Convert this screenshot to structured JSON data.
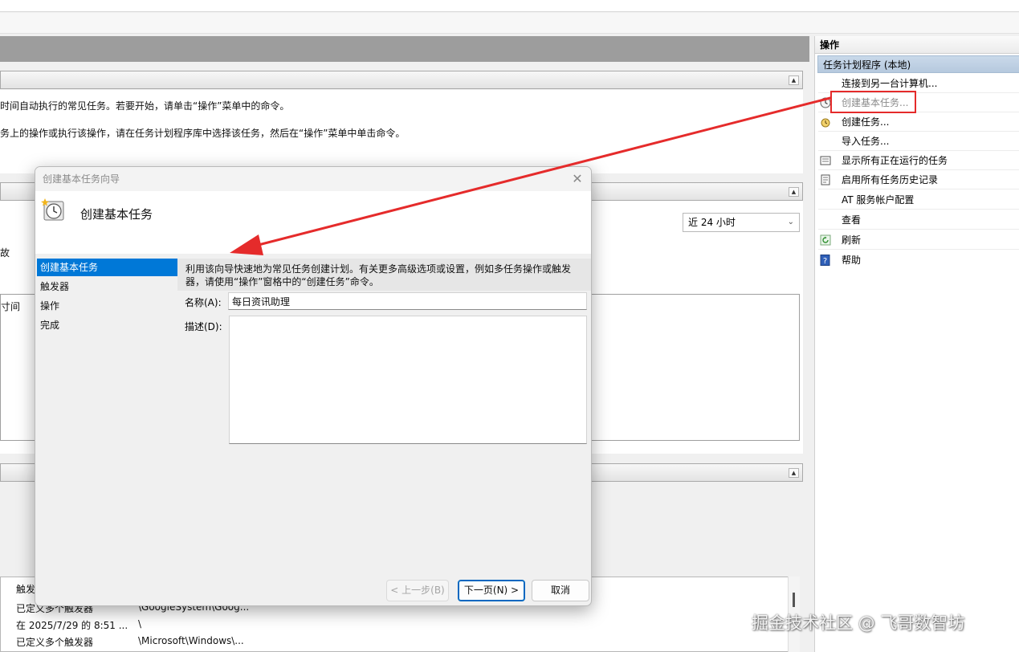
{
  "background": {
    "overview_line1": "时间自动执行的常见任务。若要开始，请单击“操作”菜单中的命令。",
    "overview_line2": "务上的操作或执行该操作，请在任务计划程序库中选择该任务，然后在“操作”菜单中单击命令。",
    "status_fragment": "故",
    "table_column_fragment": "寸间",
    "time_range": "近 24 小时",
    "list_header": "触发",
    "list_rows": [
      {
        "trigger": "已定义多个触发器",
        "location": "\\GoogleSystem\\Goog..."
      },
      {
        "trigger": "在 2025/7/29 的 8:51 ...",
        "location": "\\"
      },
      {
        "trigger": "已定义多个触发器",
        "location": "\\Microsoft\\Windows\\..."
      }
    ]
  },
  "actions": {
    "title": "操作",
    "group": "任务计划程序 (本地)",
    "items": [
      {
        "label": "连接到另一台计算机...",
        "icon": "none"
      },
      {
        "label": "创建基本任务...",
        "icon": "clock-icon"
      },
      {
        "label": "创建任务...",
        "icon": "task-icon"
      },
      {
        "label": "导入任务...",
        "icon": "none"
      },
      {
        "label": "显示所有正在运行的任务",
        "icon": "running-tasks-icon"
      },
      {
        "label": "启用所有任务历史记录",
        "icon": "history-icon"
      },
      {
        "label": "AT 服务帐户配置",
        "icon": "none"
      },
      {
        "label": "查看",
        "icon": "none"
      },
      {
        "label": "刷新",
        "icon": "refresh-icon"
      },
      {
        "label": "帮助",
        "icon": "help-icon"
      }
    ]
  },
  "dialog": {
    "title": "创建基本任务向导",
    "heading": "创建基本任务",
    "steps": [
      "创建基本任务",
      "触发器",
      "操作",
      "完成"
    ],
    "intro_line1": "利用该向导快速地为常见任务创建计划。有关更多高级选项或设置，例如多任务操作或触发",
    "intro_line2": "器，请使用“操作”窗格中的“创建任务”命令。",
    "name_label": "名称(A):",
    "name_value": "每日资讯助理",
    "desc_label": "描述(D):",
    "desc_value": "",
    "buttons": {
      "back": "< 上一步(B)",
      "next": "下一页(N) >",
      "cancel": "取消"
    }
  },
  "colors": {
    "highlight": "#0078d7",
    "annotation_red": "#e52b2b",
    "actions_group_bg": "#c9d9ea"
  },
  "watermark": "掘金技术社区 @ 飞哥数智坊"
}
